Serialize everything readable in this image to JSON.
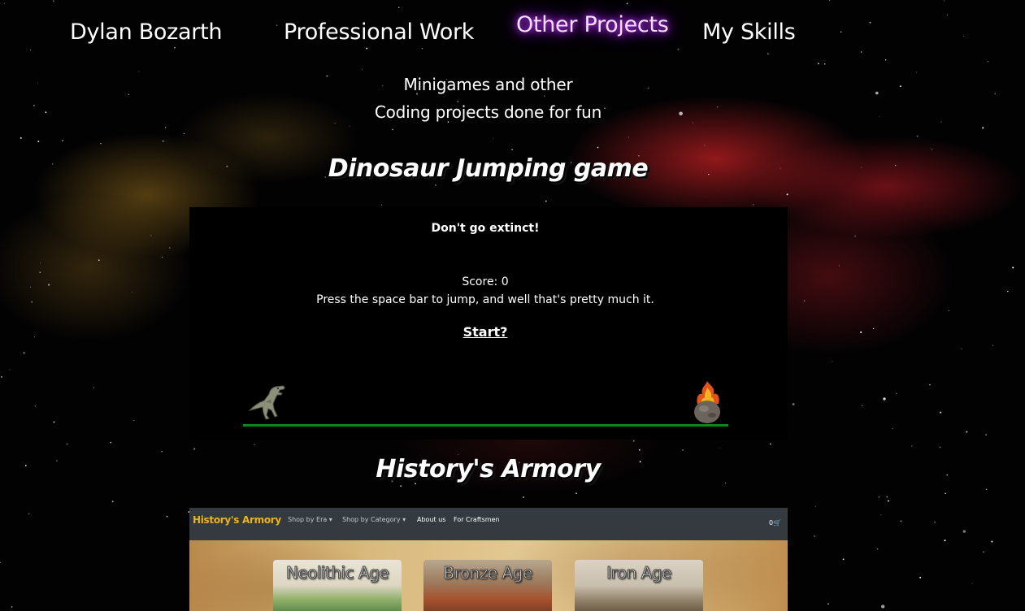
{
  "nav": {
    "home": "Dylan Bozarth",
    "professional": "Professional Work",
    "other": "Other Projects",
    "skills": "My Skills"
  },
  "intro": {
    "line1": "Minigames and other",
    "line2": "Coding projects done for fun"
  },
  "projects": [
    {
      "title": "Dinosaur Jumping game",
      "game": {
        "heading": "Don't go extinct!",
        "score": "Score: 0",
        "instructions": "Press the space bar to jump, and well that's pretty much it.",
        "start": "Start?"
      }
    },
    {
      "title": "History's Armory",
      "preview": {
        "brand": "History's Armory",
        "links": [
          "Shop by Era ▾",
          "Shop by Category ▾",
          "About us",
          "For Craftsmen"
        ],
        "cart": "0🛒",
        "eras": [
          "Neolithic Age",
          "Bronze Age",
          "Iron Age"
        ]
      }
    }
  ],
  "colors": {
    "active_nav_glow": "#c13bff",
    "ground": "#0a8a1a",
    "brand": "#e8b32a"
  },
  "icons": [
    "dinosaur-icon",
    "meteor-icon",
    "cart-icon"
  ]
}
